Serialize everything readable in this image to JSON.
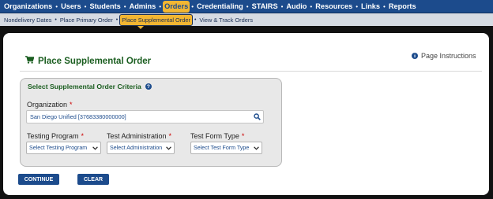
{
  "topnav": {
    "items": [
      {
        "label": "Organizations"
      },
      {
        "label": "Users"
      },
      {
        "label": "Students"
      },
      {
        "label": "Admins"
      },
      {
        "label": "Orders"
      },
      {
        "label": "Credentialing"
      },
      {
        "label": "STAIRS"
      },
      {
        "label": "Audio"
      },
      {
        "label": "Resources"
      },
      {
        "label": "Links"
      },
      {
        "label": "Reports"
      }
    ],
    "active": "Orders",
    "separator": "•"
  },
  "subnav": {
    "items": [
      {
        "label": "Nondelivery Dates"
      },
      {
        "label": "Place Primary Order"
      },
      {
        "label": "Place Supplemental Order"
      },
      {
        "label": "View & Track Orders"
      }
    ],
    "active": "Place Supplemental Order",
    "separator": "•"
  },
  "page": {
    "title": "Place Supplemental Order",
    "title_icon": "shopping-cart-icon",
    "instructions_link": "Page Instructions",
    "instructions_icon": "info-icon"
  },
  "criteria": {
    "title": "Select Supplemental Order Criteria",
    "help_icon": "help-icon",
    "required_marker": "*",
    "organization": {
      "label": "Organization",
      "value": "San Diego Unified [37683380000000]"
    },
    "testing_program": {
      "label": "Testing Program",
      "value": "Select Testing Program"
    },
    "test_administration": {
      "label": "Test Administration",
      "value": "Select Administration"
    },
    "test_form_type": {
      "label": "Test Form Type",
      "value": "Select Test Form Type"
    }
  },
  "buttons": {
    "continue": "CONTINUE",
    "clear": "CLEAR"
  },
  "colors": {
    "nav_bg": "#1c4b8c",
    "active_tab": "#f2b632",
    "title_green": "#1b5e20",
    "required_red": "#cc0000"
  }
}
